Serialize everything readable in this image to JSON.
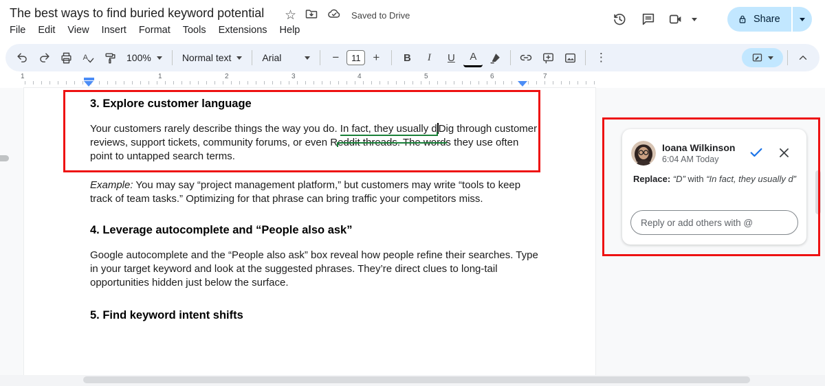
{
  "header": {
    "title": "The best ways to find buried keyword potential",
    "saved_status": "Saved to Drive",
    "share_label": "Share"
  },
  "menus": [
    "File",
    "Edit",
    "View",
    "Insert",
    "Format",
    "Tools",
    "Extensions",
    "Help"
  ],
  "toolbar": {
    "zoom": "100%",
    "style": "Normal text",
    "font": "Arial",
    "font_size": "11",
    "minus": "−",
    "plus": "+",
    "bold": "B",
    "italic": "I",
    "underline": "U",
    "text_color": "A",
    "more": "⋮"
  },
  "icons": {
    "star": "☆"
  },
  "ruler": {
    "numbers": [
      "1",
      "1",
      "2",
      "3",
      "4",
      "5",
      "6",
      "7"
    ]
  },
  "document": {
    "heading3": "3. Explore customer language",
    "p1_before": "Your customers rarely describe things the way you do. ",
    "p1_suggestion": "In fact, they usually d",
    "p1_after": "Dig through customer reviews, support tickets, community forums, or even Reddit threads. The words they use often point to untapped search terms.",
    "p2_label": "Example:",
    "p2_text": " You may say “project management platform,” but customers may write “tools to keep track of team tasks.” Optimizing for that phrase can bring traffic your competitors miss.",
    "heading4": "4. Leverage autocomplete and “People also ask”",
    "p3": "Google autocomplete and the “People also ask” box reveal how people refine their searches. Type in your target keyword and look at the suggested phrases. They’re direct clues to long-tail opportunities hidden just below the surface.",
    "heading5": "5. Find keyword intent shifts"
  },
  "comment": {
    "author": "Ioana Wilkinson",
    "timestamp": "6:04 AM Today",
    "action_label": "Replace:",
    "quote1": "“D”",
    "mid": " with ",
    "quote2": "“In fact, they usually d”",
    "reply_placeholder": "Reply or add others with @"
  },
  "colors": {
    "share_button": "#c2e7ff",
    "toolbar_bg": "#edf2fa",
    "annotation_red": "#ee1212",
    "suggestion_green": "#188038",
    "accept_check_blue": "#1a73e8",
    "indent_marker_blue": "#4c8df6"
  }
}
